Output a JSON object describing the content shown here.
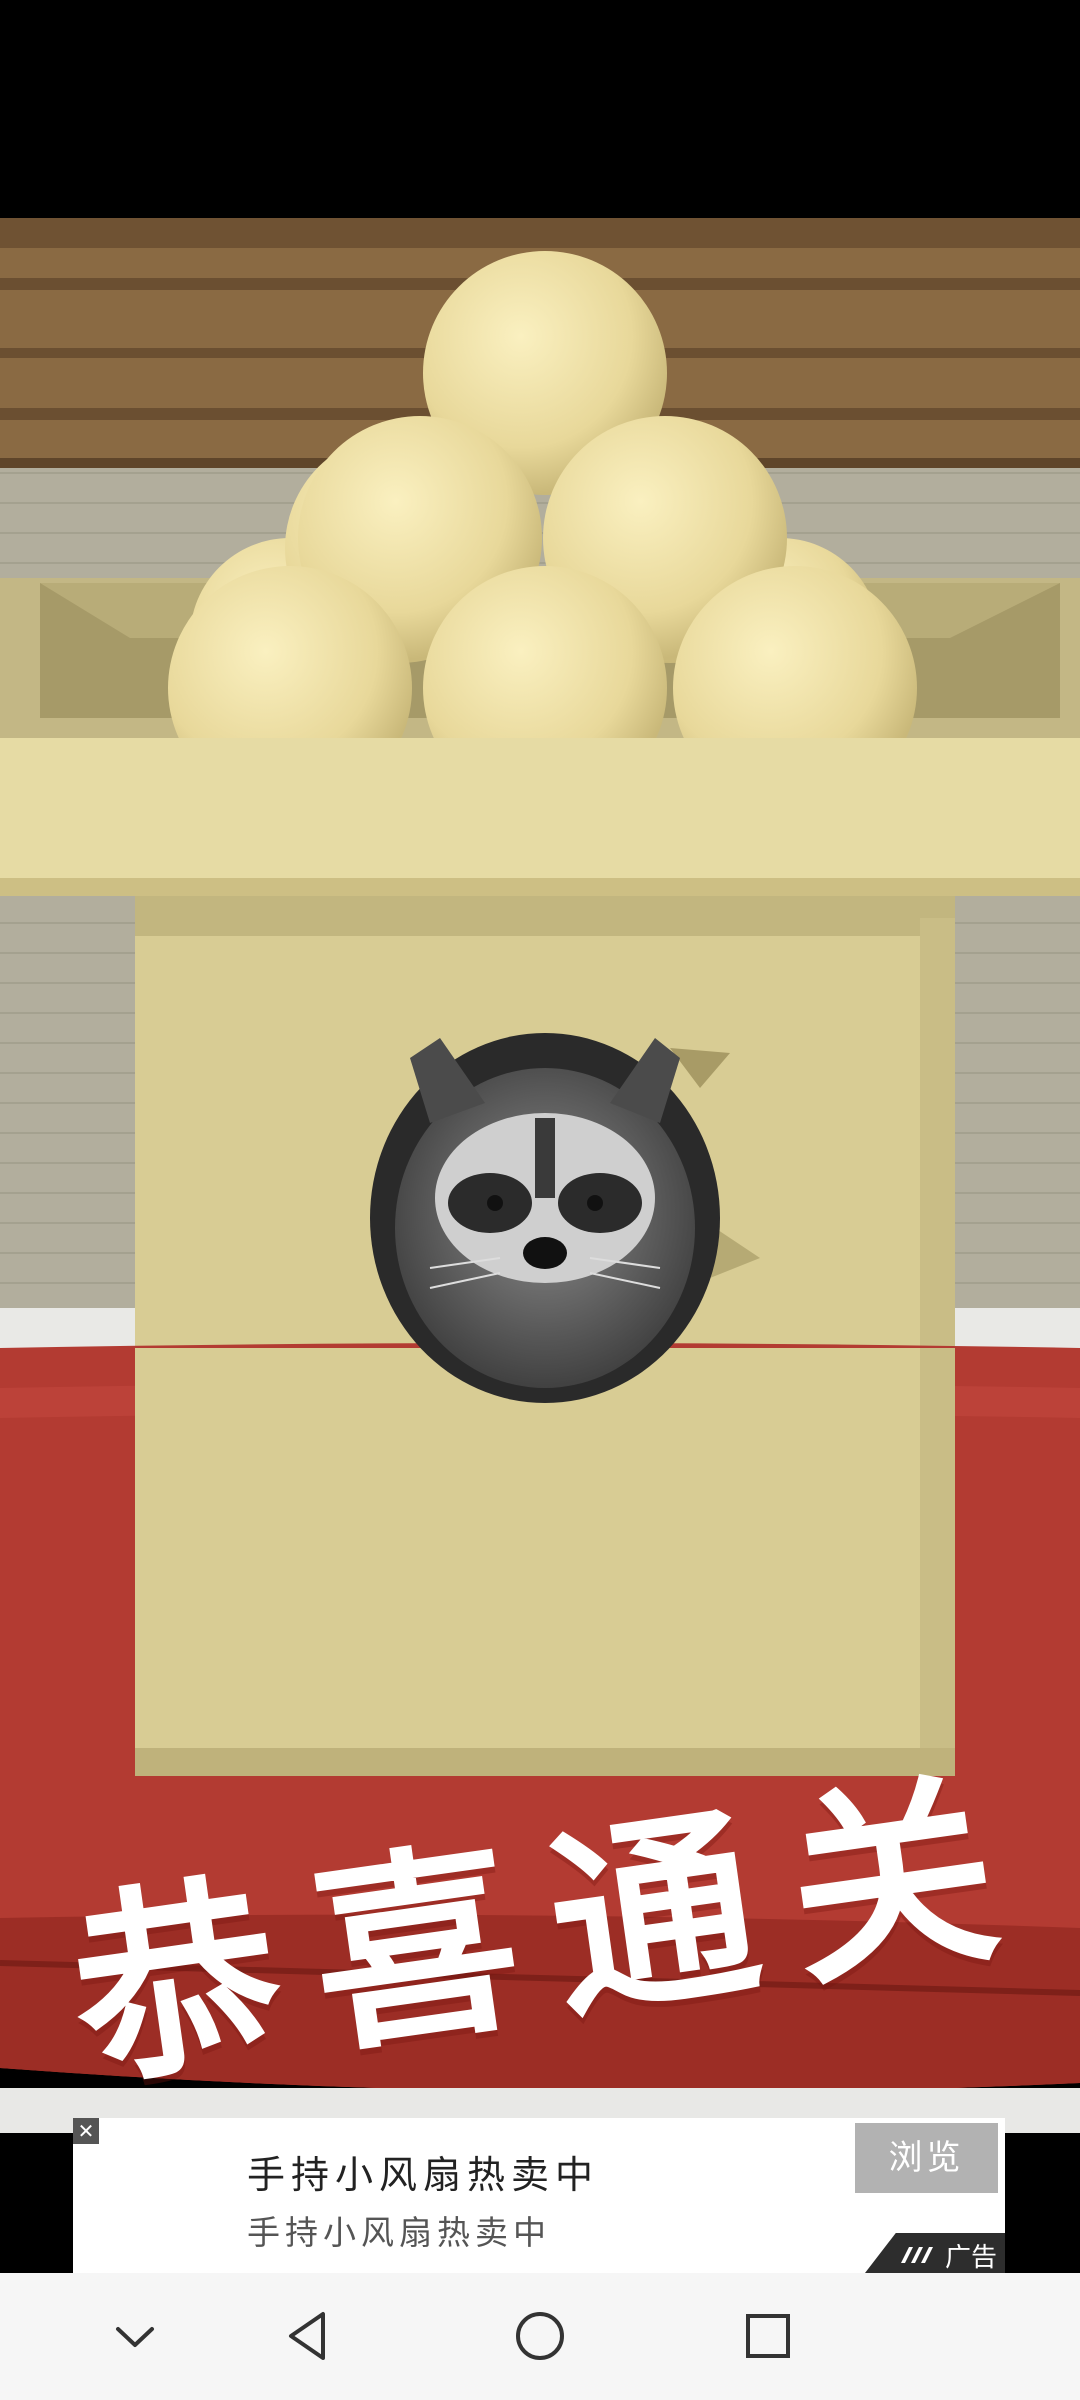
{
  "game": {
    "clear_message": "恭喜通关"
  },
  "ad": {
    "title": "手持小风扇热卖中",
    "subtitle": "手持小风扇热卖中",
    "button_label": "浏览",
    "tag_label": "广告",
    "close_icon": "close-icon"
  },
  "nav": {
    "icons": [
      "chevron-down-icon",
      "back-icon",
      "home-icon",
      "recents-icon"
    ]
  },
  "colors": {
    "cushion": "#b33b32",
    "box": "#d8cc94",
    "dango": "#efe2a6",
    "wood": "#8a6a43",
    "tatami": "#a9a594"
  }
}
